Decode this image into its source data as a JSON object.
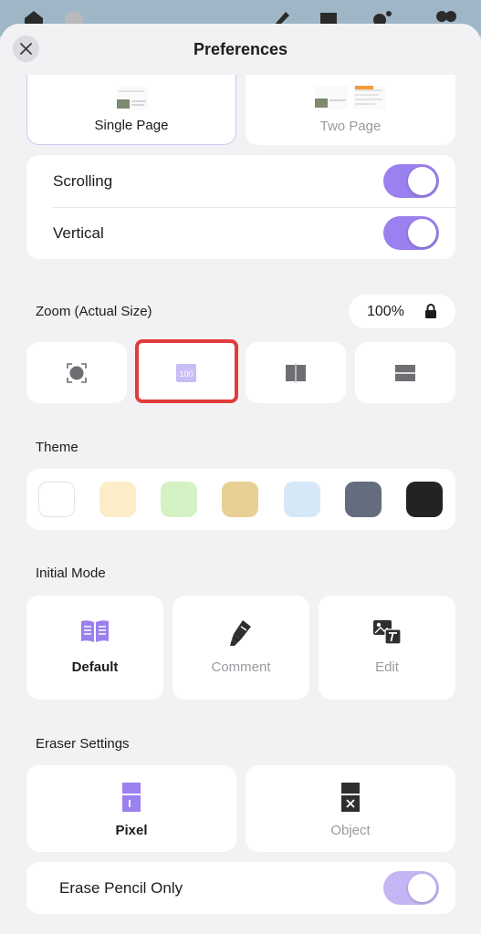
{
  "header": {
    "title": "Preferences"
  },
  "page_layout": {
    "options": [
      {
        "label": "Single Page",
        "selected": true
      },
      {
        "label": "Two Page",
        "selected": false
      }
    ]
  },
  "scrolling": {
    "rows": [
      {
        "label": "Scrolling",
        "on": true
      },
      {
        "label": "Vertical",
        "on": true
      }
    ]
  },
  "zoom": {
    "label": "Zoom (Actual Size)",
    "value": "100%",
    "mode_icons": [
      "fit-page-icon",
      "actual-size-icon",
      "fit-width-icon",
      "fit-height-icon"
    ],
    "selected_index": 1,
    "actual_size_text": "100"
  },
  "theme": {
    "label": "Theme",
    "swatches": [
      "#ffffff",
      "#fdecc8",
      "#d3f1c2",
      "#e9cf93",
      "#d6e8f8",
      "#646d7d",
      "#232323"
    ]
  },
  "initial_mode": {
    "label": "Initial Mode",
    "options": [
      {
        "label": "Default",
        "icon": "book-icon",
        "selected": true
      },
      {
        "label": "Comment",
        "icon": "highlighter-icon",
        "selected": false
      },
      {
        "label": "Edit",
        "icon": "image-text-icon",
        "selected": false
      }
    ]
  },
  "eraser": {
    "label": "Eraser Settings",
    "options": [
      {
        "label": "Pixel",
        "icon": "pixel-eraser-icon",
        "selected": true
      },
      {
        "label": "Object",
        "icon": "object-eraser-icon",
        "selected": false
      }
    ],
    "pencil_only": {
      "label": "Erase Pencil Only",
      "on": true
    }
  },
  "colors": {
    "accent": "#9b80ef",
    "selected_border": "#cfc6f5",
    "highlight": "#e23b3b"
  }
}
